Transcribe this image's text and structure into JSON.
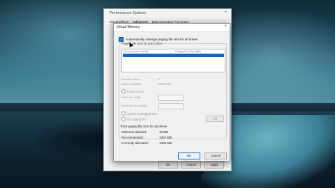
{
  "performance_options": {
    "title": "Performance Options",
    "close_glyph": "×",
    "tabs": [
      "Visual Effects",
      "Advanced",
      "Data Execution Prevention"
    ],
    "buttons": [
      "OK",
      "Cancel",
      "Apply"
    ]
  },
  "virtual_memory": {
    "title": "Virtual Memory",
    "close_glyph": "×",
    "auto_manage_label": "Automatically manage paging file size for all drives",
    "auto_manage_checked": true,
    "group_title": "Paging file size for each drive",
    "columns": [
      "Drive [Volume Label]",
      "Paging File Size (MB)"
    ],
    "selected_drive_label": "Selected drive:",
    "selected_drive_value": "C:",
    "space_available_label": "Space available:",
    "space_available_value": "89855 MB",
    "custom_size_label": "Custom size:",
    "initial_size_label": "Initial size (MB):",
    "maximum_size_label": "Maximum size (MB):",
    "system_managed_label": "System managed size",
    "no_paging_label": "No paging file",
    "set_button": "Set",
    "total_label": "Total paging file size for all drives",
    "stats": [
      {
        "label": "Minimum allowed:",
        "value": "16 MB"
      },
      {
        "label": "Recommended:",
        "value": "1407 MB"
      },
      {
        "label": "Currently allocated:",
        "value": "1408 MB"
      }
    ],
    "ok_button": "OK",
    "cancel_button": "Cancel"
  }
}
